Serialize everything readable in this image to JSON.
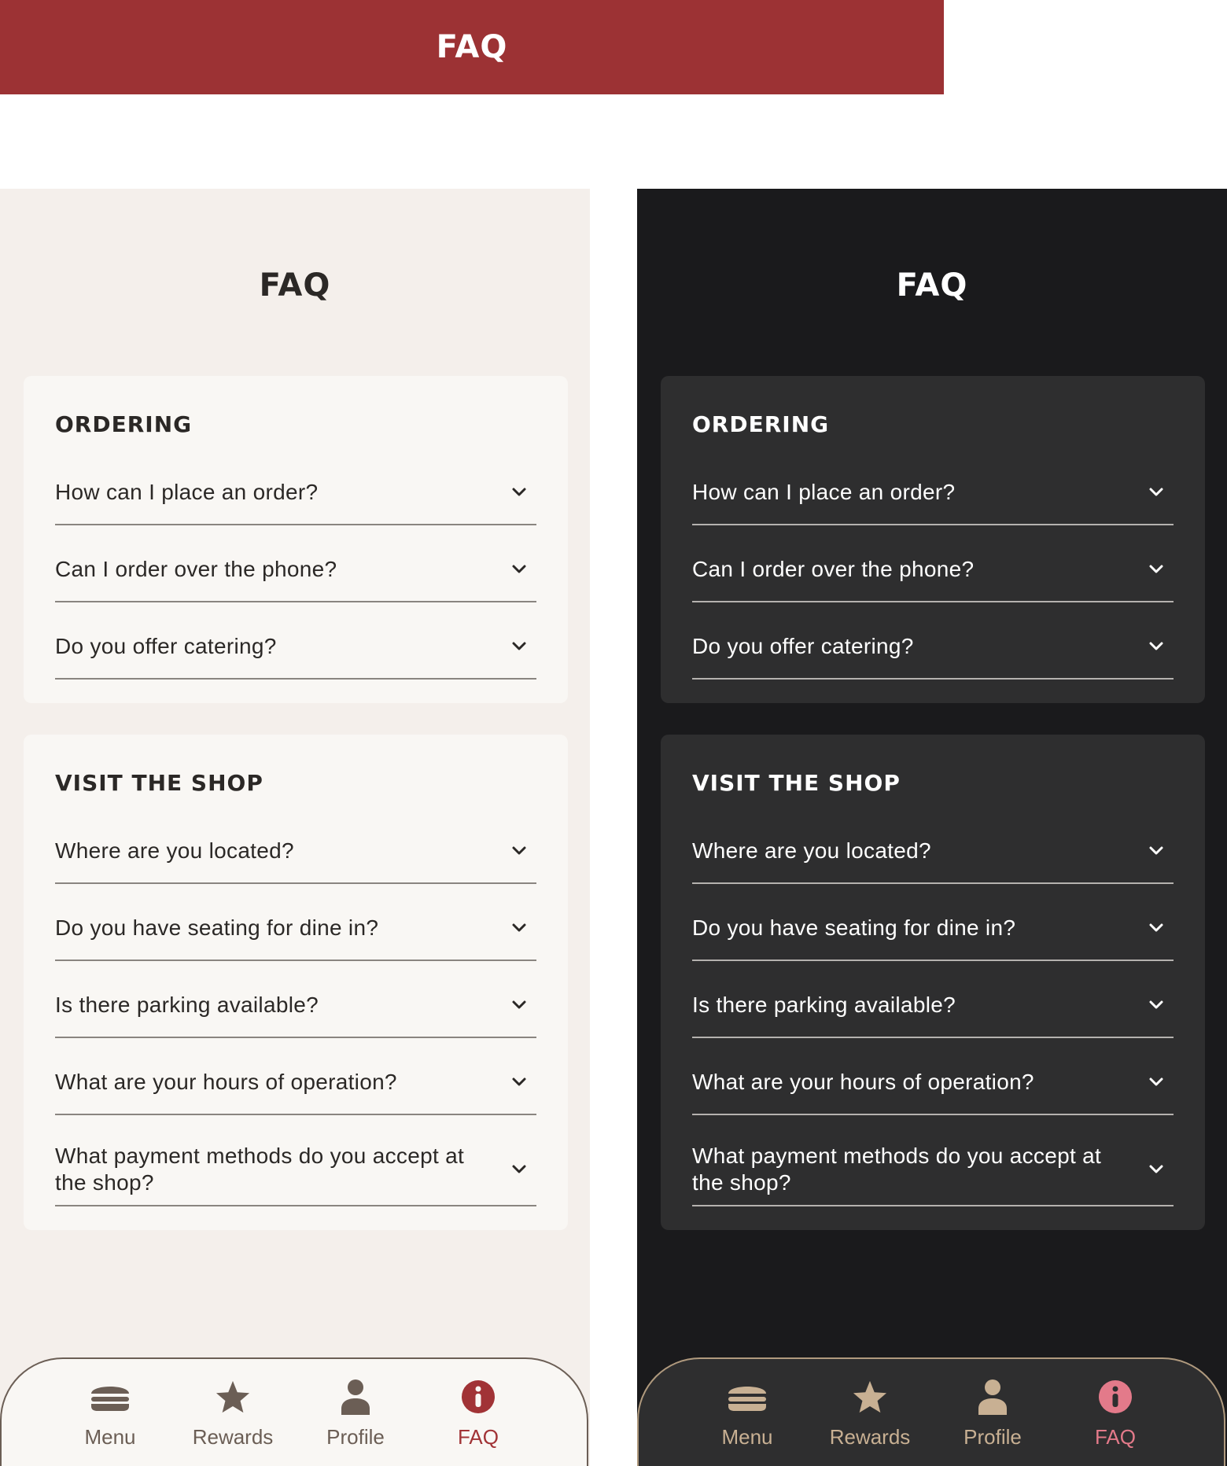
{
  "banner": {
    "title": "FAQ"
  },
  "screens": {
    "light": {
      "title": "FAQ",
      "sections": [
        {
          "title": "ORDERING",
          "questions": [
            "How can I place an order?",
            "Can I order over the phone?",
            "Do you offer catering?"
          ]
        },
        {
          "title": "VISIT THE SHOP",
          "questions": [
            "Where are you located?",
            "Do you have seating for dine in?",
            "Is there parking available?",
            "What are your hours of operation?",
            "What payment methods do you accept at the shop?"
          ]
        }
      ],
      "tabs": [
        {
          "label": "Menu",
          "icon": "burger-icon"
        },
        {
          "label": "Rewards",
          "icon": "star-icon"
        },
        {
          "label": "Profile",
          "icon": "person-icon"
        },
        {
          "label": "FAQ",
          "icon": "info-icon",
          "active": true
        }
      ]
    },
    "dark": {
      "title": "FAQ",
      "sections": [
        {
          "title": "ORDERING",
          "questions": [
            "How can I place an order?",
            "Can I order over the phone?",
            "Do you offer catering?"
          ]
        },
        {
          "title": "VISIT THE SHOP",
          "questions": [
            "Where are you located?",
            "Do you have seating for dine in?",
            "Is there parking available?",
            "What are your hours of operation?",
            "What payment methods do you accept at the shop?"
          ]
        }
      ],
      "tabs": [
        {
          "label": "Menu",
          "icon": "burger-icon"
        },
        {
          "label": "Rewards",
          "icon": "star-icon"
        },
        {
          "label": "Profile",
          "icon": "person-icon"
        },
        {
          "label": "FAQ",
          "icon": "info-icon",
          "active": true
        }
      ]
    }
  },
  "colors": {
    "banner": "#9c3234",
    "light_bg": "#f4efeb",
    "light_card": "#f9f7f4",
    "dark_bg": "#1a1a1c",
    "dark_card": "#2e2e2f",
    "light_icon": "#6b5e55",
    "dark_icon": "#c8b093",
    "light_active": "#a13336",
    "dark_active": "#e37a8a"
  }
}
